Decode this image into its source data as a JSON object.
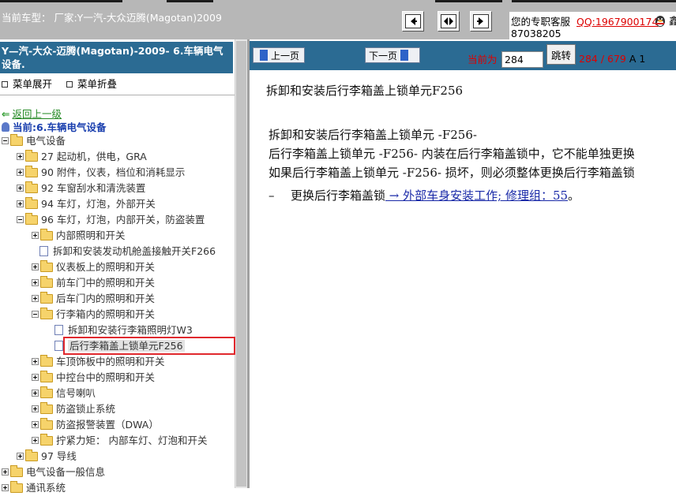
{
  "topbar": {
    "vehicle_info": "当前车型：  厂家:Y一汽-大众迈腾(Magotan)2009",
    "support_label": "您的专职客服",
    "support_qq": "QQ:1967900174",
    "support_tail": "鑫",
    "support_phone": "87038205"
  },
  "left": {
    "header": "Y—汽-大众-迈腾(Magotan)-2009- 6.车辆电气设备.",
    "expand_all": "菜单展开",
    "collapse_all": "菜单折叠",
    "back": "返回上一级",
    "current": "当前:6.车辆电气设备",
    "tree": [
      {
        "label": "电气设备",
        "type": "folder",
        "exp": "minus"
      },
      {
        "label": "27 起动机，供电，GRA",
        "type": "folder",
        "exp": "plus"
      },
      {
        "label": "90 附件，仪表，档位和消耗显示",
        "type": "folder",
        "exp": "plus"
      },
      {
        "label": "92 车窗刮水和清洗装置",
        "type": "folder",
        "exp": "plus"
      },
      {
        "label": "94 车灯，灯泡，外部开关",
        "type": "folder",
        "exp": "plus"
      },
      {
        "label": "96 车灯，灯泡，内部开关，防盗装置",
        "type": "folder",
        "exp": "minus"
      },
      {
        "label": "内部照明和开关",
        "type": "folder",
        "exp": "plus"
      },
      {
        "label": "拆卸和安装发动机舱盖接触开关F266",
        "type": "doc"
      },
      {
        "label": "仪表板上的照明和开关",
        "type": "folder",
        "exp": "plus"
      },
      {
        "label": "前车门中的照明和开关",
        "type": "folder",
        "exp": "plus"
      },
      {
        "label": "后车门内的照明和开关",
        "type": "folder",
        "exp": "plus"
      },
      {
        "label": "行李箱内的照明和开关",
        "type": "folder",
        "exp": "minus"
      },
      {
        "label": "拆卸和安装行李箱照明灯W3",
        "type": "doc"
      },
      {
        "label": "后行李箱盖上锁单元F256",
        "type": "doc",
        "selected": true
      },
      {
        "label": "车顶饰板中的照明和开关",
        "type": "folder",
        "exp": "plus"
      },
      {
        "label": "中控台中的照明和开关",
        "type": "folder",
        "exp": "plus"
      },
      {
        "label": "信号喇叭",
        "type": "folder",
        "exp": "plus"
      },
      {
        "label": "防盗锁止系统",
        "type": "folder",
        "exp": "plus"
      },
      {
        "label": "防盗报警装置（DWA）",
        "type": "folder",
        "exp": "plus"
      },
      {
        "label": "拧紧力矩： 内部车灯、灯泡和开关",
        "type": "folder",
        "exp": "plus"
      },
      {
        "label": "97 导线",
        "type": "folder",
        "exp": "plus"
      },
      {
        "label": "电气设备一般信息",
        "type": "folder",
        "exp": "plus"
      },
      {
        "label": "通讯系统",
        "type": "folder",
        "exp": "plus"
      }
    ]
  },
  "right": {
    "prev_label": "上一页",
    "next_label": "下一页",
    "page_label": "当前为",
    "page_value": "284",
    "jump_label": "跳转",
    "page_count": "284 / 679",
    "page_suffix": "A 1",
    "title": "拆卸和安装后行李箱盖上锁单元F256",
    "para1": "拆卸和安装后行李箱盖上锁单元  -F256-",
    "para2": "后行李箱盖上锁单元  -F256- 内装在后行李箱盖锁中，它不能单独更换",
    "para3": "如果后行李箱盖上锁单元  -F256- 损坏，则必须整体更换后行李箱盖锁",
    "step_dash": "–",
    "step_text": "更换后行李箱盖锁",
    "step_link": " → 外部车身安装工作; 修理组：55",
    "step_end": "。"
  },
  "colors": {
    "header_blue": "#2b6b93",
    "selection_red": "#e0282d",
    "link_blue": "#1a2aa8"
  }
}
